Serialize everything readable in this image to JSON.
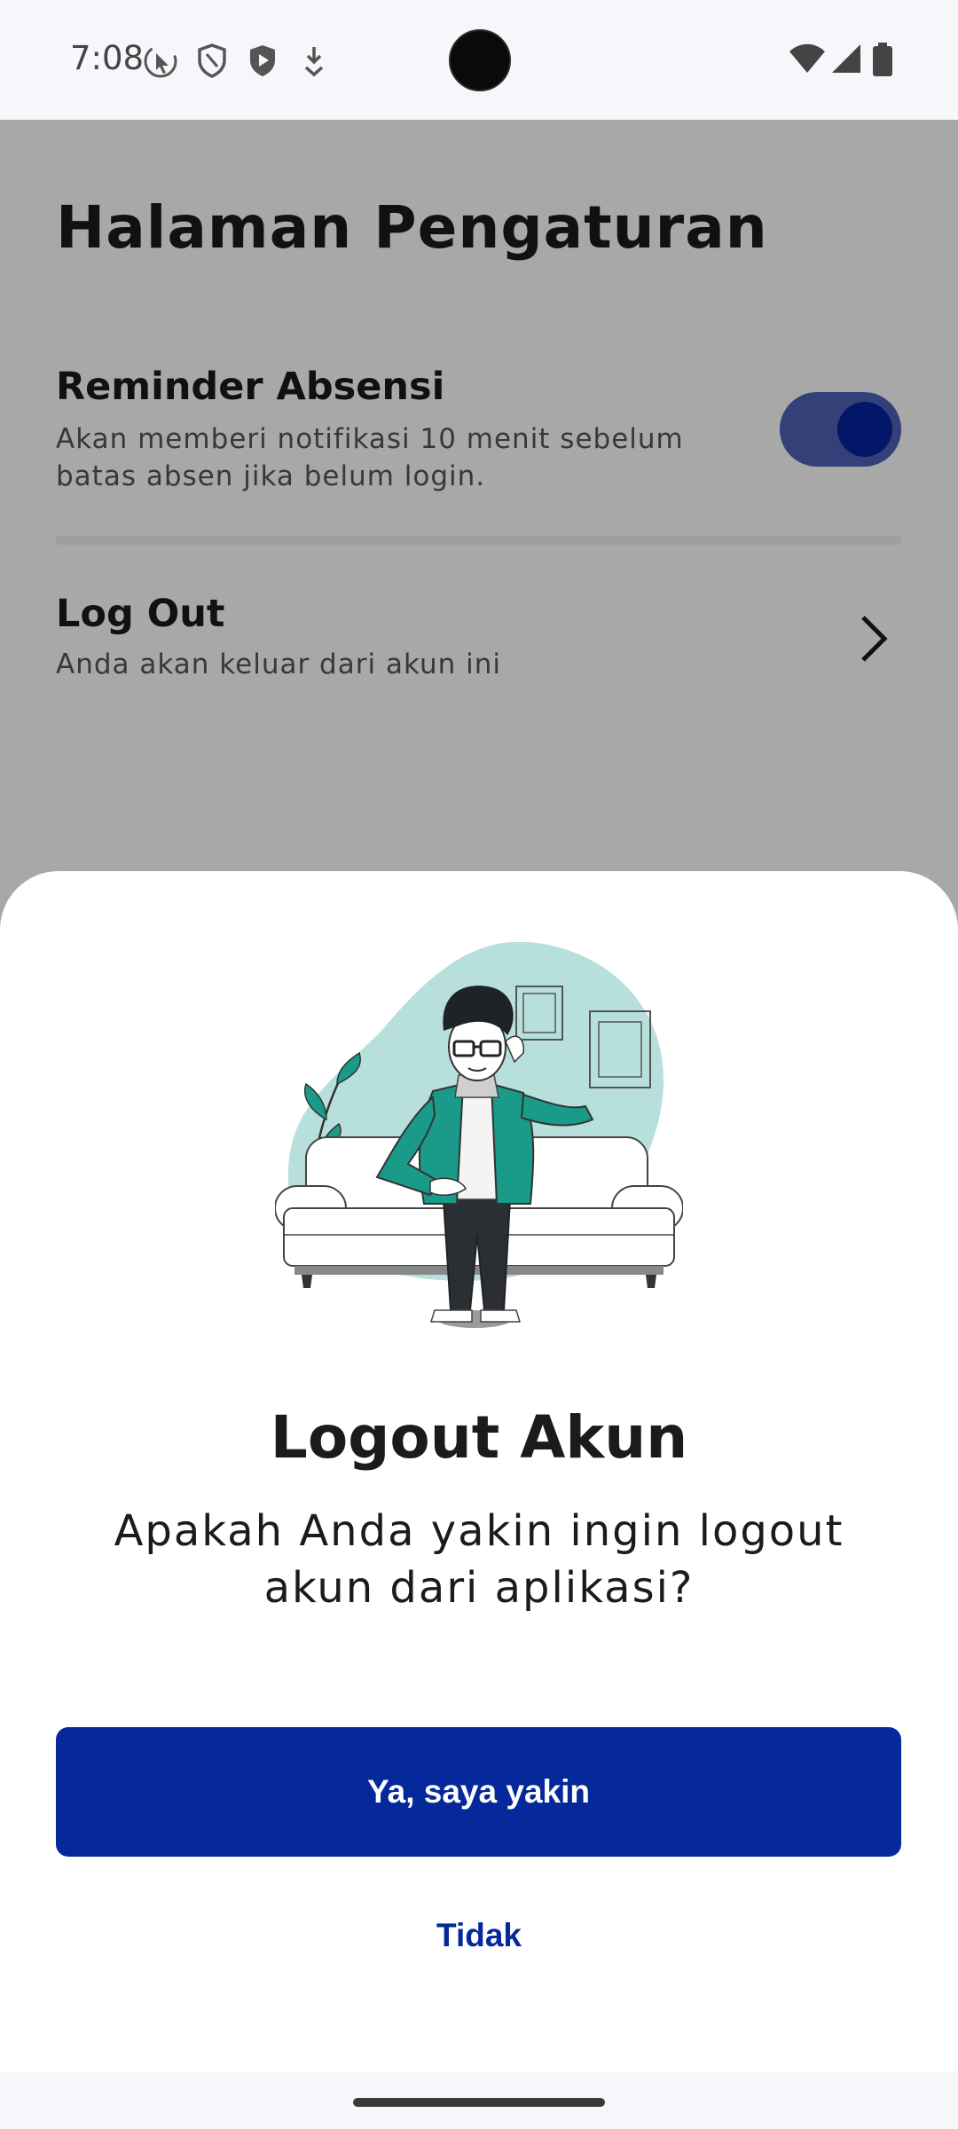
{
  "status_bar": {
    "time": "7:08",
    "icons": [
      "pointer-icon",
      "shield-icon",
      "play-shield-icon",
      "download-icon",
      "wifi-icon",
      "signal-icon",
      "battery-icon"
    ]
  },
  "page": {
    "title": "Halaman Pengaturan",
    "settings": [
      {
        "title": "Reminder Absensi",
        "description": "Akan memberi notifikasi 10 menit sebelum batas absen jika belum login.",
        "toggle_on": true
      },
      {
        "title": "Log Out",
        "description": "Anda akan keluar dari akun ini",
        "icon": "chevron-right-icon"
      }
    ]
  },
  "dialog": {
    "title": "Logout Akun",
    "message": "Apakah Anda yakin ingin logout akun dari aplikasi?",
    "confirm_label": "Ya, saya yakin",
    "cancel_label": "Tidak"
  },
  "colors": {
    "primary": "#05299b",
    "toggle_track": "#4e63b6",
    "illustration_accent": "#1a9b8a",
    "illustration_blob": "#b7e0dc"
  }
}
